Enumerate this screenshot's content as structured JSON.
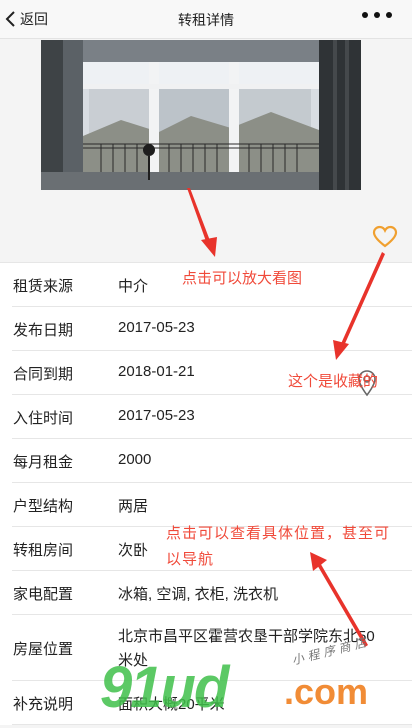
{
  "nav": {
    "back_label": "返回",
    "title": "转租详情"
  },
  "details": [
    {
      "label": "租赁来源",
      "value": "中介"
    },
    {
      "label": "发布日期",
      "value": "2017-05-23"
    },
    {
      "label": "合同到期",
      "value": "2018-01-21"
    },
    {
      "label": "入住时间",
      "value": "2017-05-23"
    },
    {
      "label": "每月租金",
      "value": "2000"
    },
    {
      "label": "户型结构",
      "value": "两居"
    },
    {
      "label": "转租房间",
      "value": "次卧"
    },
    {
      "label": "家电配置",
      "value": "冰箱, 空调, 衣柜, 洗衣机"
    },
    {
      "label": "房屋位置",
      "value": "北京市昌平区霍营农垦干部学院东北50米处"
    },
    {
      "label": "补充说明",
      "value": "面积大概20平米"
    }
  ],
  "annotations": {
    "zoom_hint": "点击可以放大看图",
    "fav_hint": "这个是收藏的",
    "location_hint": "点击可以查看具体位置，甚至可以导航"
  },
  "watermark": {
    "brand": "91ud",
    "domain": ".com",
    "shop": "小程序商店"
  },
  "colors": {
    "accent": "#f0a030",
    "annotation": "#f04a3a",
    "watermark": "#3fbf4a"
  }
}
